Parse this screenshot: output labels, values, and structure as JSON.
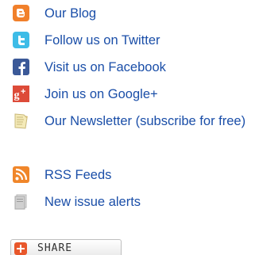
{
  "links": {
    "blog": "Our Blog",
    "twitter": "Follow us on Twitter",
    "facebook": "Visit us on Facebook",
    "google_plus": "Join us on Google+",
    "newsletter": "Our Newsletter (subscribe for free)",
    "rss": "RSS Feeds",
    "alerts": "New issue alerts"
  },
  "share": {
    "label": "SHARE"
  },
  "colors": {
    "link": "#1a4ea8",
    "blogger_orange": "#f1802b",
    "twitter_blue": "#3ebce7",
    "facebook_blue": "#3b5998",
    "google_red": "#dd4b39",
    "rss_orange": "#f0862a",
    "share_orange": "#e8572b"
  },
  "icons": [
    "blogger-icon",
    "twitter-icon",
    "facebook-icon",
    "google-plus-icon",
    "newsletter-icon",
    "rss-icon",
    "alerts-icon",
    "share-icon"
  ]
}
